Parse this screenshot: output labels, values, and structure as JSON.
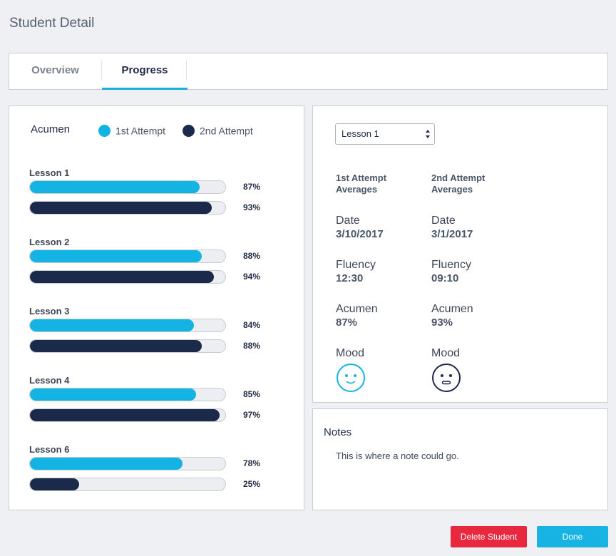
{
  "page": {
    "title": "Student Detail"
  },
  "tabs": [
    {
      "label": "Overview",
      "active": false
    },
    {
      "label": "Progress",
      "active": true
    }
  ],
  "progress": {
    "title": "Acumen",
    "legend": [
      {
        "label": "1st Attempt",
        "color": "#13b4e4"
      },
      {
        "label": "2nd Attempt",
        "color": "#1b2a4a"
      }
    ],
    "lessons": [
      {
        "name": "Lesson 1",
        "attempt1": 87,
        "attempt1_label": "87%",
        "attempt2": 93,
        "attempt2_label": "93%"
      },
      {
        "name": "Lesson 2",
        "attempt1": 88,
        "attempt1_label": "88%",
        "attempt2": 94,
        "attempt2_label": "94%"
      },
      {
        "name": "Lesson 3",
        "attempt1": 84,
        "attempt1_label": "84%",
        "attempt2": 88,
        "attempt2_label": "88%"
      },
      {
        "name": "Lesson 4",
        "attempt1": 85,
        "attempt1_label": "85%",
        "attempt2": 97,
        "attempt2_label": "97%"
      },
      {
        "name": "Lesson 6",
        "attempt1": 78,
        "attempt1_label": "78%",
        "attempt2": 25,
        "attempt2_label": "25%"
      }
    ]
  },
  "stats": {
    "lesson_select": {
      "value": "Lesson 1"
    },
    "columns": [
      {
        "heading": "1st Attempt Averages",
        "date_label": "Date",
        "date": "3/10/2017",
        "fluency_label": "Fluency",
        "fluency": "12:30",
        "acumen_label": "Acumen",
        "acumen": "87%",
        "mood_label": "Mood",
        "mood_icon": "happy-face-icon",
        "mood_color": "#13b4e4"
      },
      {
        "heading": "2nd Attempt Averages",
        "date_label": "Date",
        "date": "3/1/2017",
        "fluency_label": "Fluency",
        "fluency": "09:10",
        "acumen_label": "Acumen",
        "acumen": "93%",
        "mood_label": "Mood",
        "mood_icon": "neutral-face-icon",
        "mood_color": "#1b2a4a"
      }
    ]
  },
  "notes": {
    "title": "Notes",
    "text": "This is where a note could go."
  },
  "actions": {
    "delete_label": "Delete Student",
    "done_label": "Done"
  }
}
